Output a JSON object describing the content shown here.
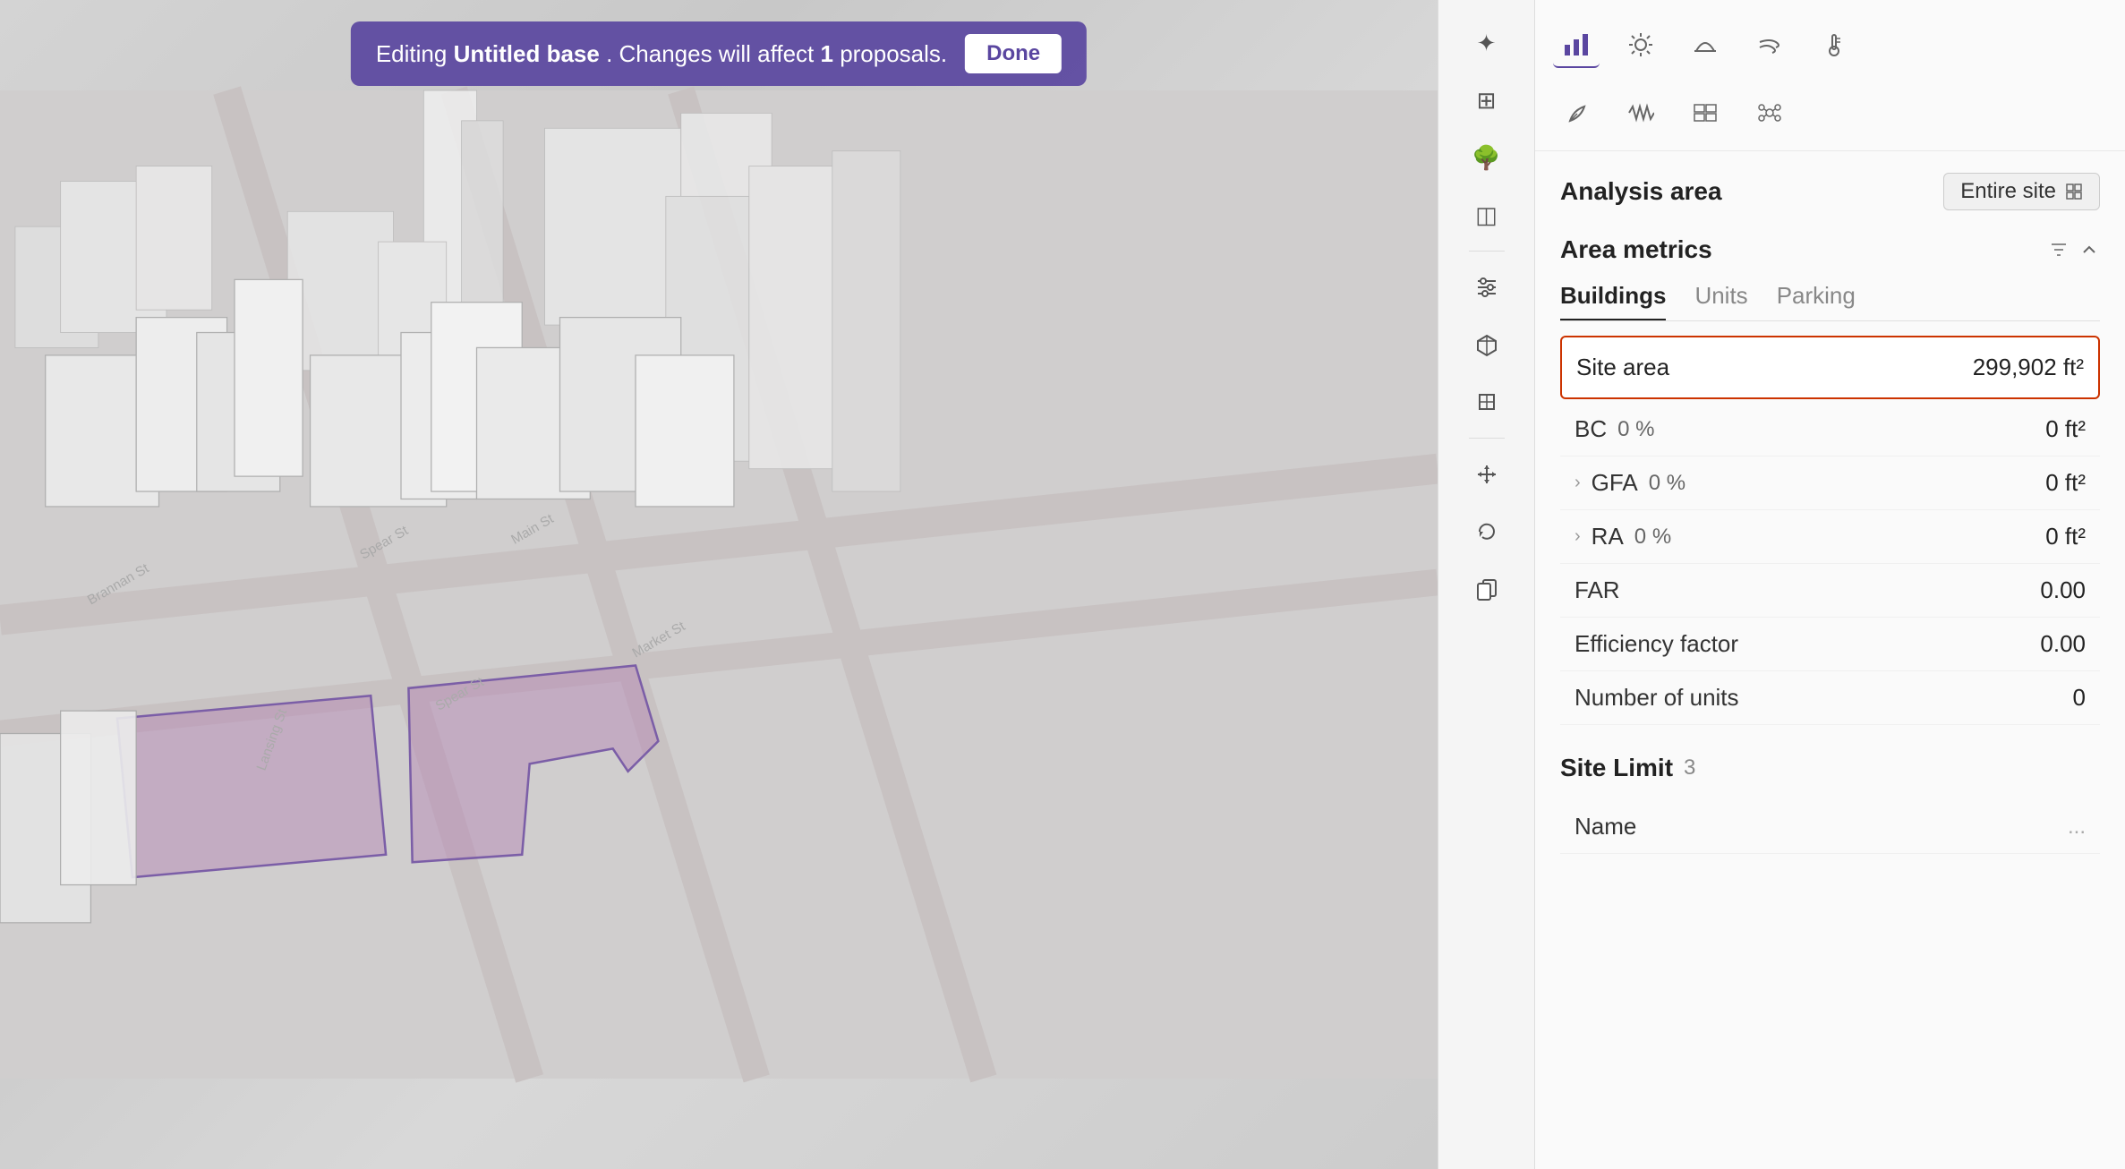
{
  "notification": {
    "text_prefix": "Editing ",
    "project_name": "Untitled base",
    "text_suffix": ". Changes will affect ",
    "proposals_count": "1",
    "proposals_label": " proposals.",
    "done_label": "Done"
  },
  "toolbar": {
    "icons": [
      {
        "name": "analytics-icon",
        "symbol": "📊"
      },
      {
        "name": "sun-icon",
        "symbol": "☀"
      },
      {
        "name": "dome-icon",
        "symbol": "⛱"
      },
      {
        "name": "wind-icon",
        "symbol": "💨"
      },
      {
        "name": "temperature-icon",
        "symbol": "🌡"
      },
      {
        "name": "leaf-icon",
        "symbol": "🌿"
      },
      {
        "name": "waveform-icon",
        "symbol": "〰"
      },
      {
        "name": "solar-panel-icon",
        "symbol": "⊞"
      },
      {
        "name": "molecules-icon",
        "symbol": "⬡"
      }
    ],
    "active_index": 0
  },
  "tool_sidebar": {
    "tools": [
      {
        "name": "sparkle-tool",
        "symbol": "✦"
      },
      {
        "name": "blocks-tool",
        "symbol": "⊞"
      },
      {
        "name": "tree-tool",
        "symbol": "🌳"
      },
      {
        "name": "layers-tool",
        "symbol": "◫"
      },
      {
        "name": "sliders-tool",
        "symbol": "≡"
      },
      {
        "name": "cube-3d-tool",
        "symbol": "⬡"
      },
      {
        "name": "box-tool",
        "symbol": "◻"
      },
      {
        "name": "arrows-tool",
        "symbol": "⇔"
      },
      {
        "name": "refresh-tool",
        "symbol": "↺"
      },
      {
        "name": "copy-tool",
        "symbol": "❐"
      }
    ]
  },
  "right_panel": {
    "analysis_area": {
      "label": "Analysis area",
      "badge_label": "Entire site",
      "badge_icon": "grid-icon"
    },
    "area_metrics": {
      "section_label": "Area metrics",
      "controls_icon": "filter-icon",
      "expand_icon": "chevron-up-icon"
    },
    "tabs": [
      {
        "label": "Buildings",
        "active": true
      },
      {
        "label": "Units",
        "active": false
      },
      {
        "label": "Parking",
        "active": false
      }
    ],
    "site_area": {
      "label": "Site area",
      "value": "299,902 ft²"
    },
    "metrics": [
      {
        "label": "BC",
        "pct": "0 %",
        "value": "0 ft²",
        "expandable": false
      },
      {
        "label": "GFA",
        "pct": "0 %",
        "value": "0 ft²",
        "expandable": true
      },
      {
        "label": "RA",
        "pct": "0 %",
        "value": "0 ft²",
        "expandable": true
      },
      {
        "label": "FAR",
        "pct": "",
        "value": "0.00",
        "expandable": false
      },
      {
        "label": "Efficiency factor",
        "pct": "",
        "value": "0.00",
        "expandable": false
      },
      {
        "label": "Number of units",
        "pct": "",
        "value": "0",
        "expandable": false
      }
    ],
    "site_limit": {
      "label": "Site Limit",
      "count": "3",
      "name_label": "Name",
      "name_value": "..."
    }
  }
}
